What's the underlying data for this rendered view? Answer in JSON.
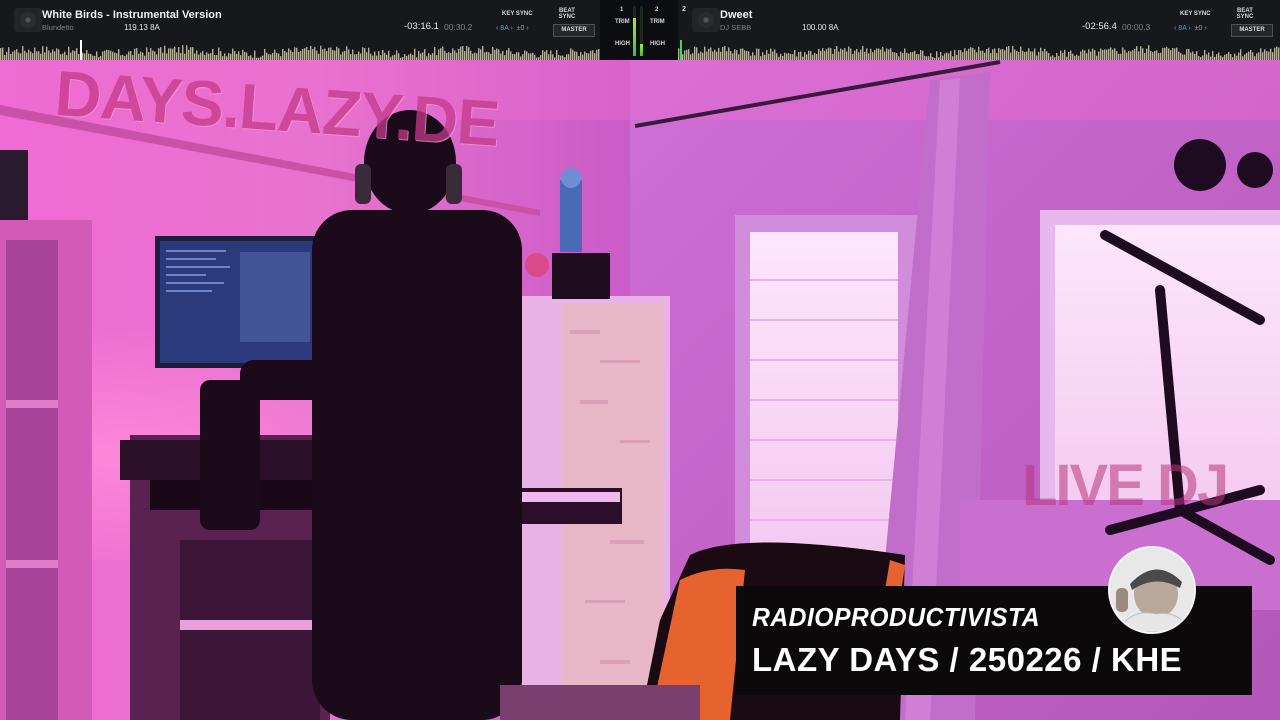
{
  "decks": {
    "left": {
      "number": "",
      "title": "White Birds - Instrumental Version",
      "artist": "Blundetto",
      "bpm_key": "119.13  8A",
      "time_remaining": "-03:16.1",
      "time_elapsed": "00:30.2",
      "key_sync_label": "KEY SYNC",
      "key_value": "8A",
      "key_offset": "±0",
      "beat_sync_label": "BEAT SYNC",
      "master_label": "MASTER"
    },
    "right": {
      "number": "2",
      "title": "Dweet",
      "artist": "DJ SEBB",
      "bpm_key": "100.00  8A",
      "time_remaining": "-02:56.4",
      "time_elapsed": "00:00.3",
      "key_sync_label": "KEY SYNC",
      "key_value": "8A",
      "key_offset": "±0",
      "beat_sync_label": "BEAT SYNC",
      "master_label": "MASTER"
    }
  },
  "mixer": {
    "ch1": "1",
    "ch2": "2",
    "trim_label": "TRIM",
    "high_label": "HIGH"
  },
  "scene": {
    "wall_text": "DAYS.LAZY.DE",
    "window_text": "LIVE DJ"
  },
  "overlay": {
    "brand": "RADIOPRODUCTIVISTA",
    "show_title": "LAZY DAYS / 250226 / KHE"
  },
  "colors": {
    "deck_bg": "#17181b",
    "key_accent": "#37a7e6",
    "waveform": "#e9e3c6",
    "room_magenta": "#e35fc6",
    "overlay_bg": "#0c090b"
  }
}
